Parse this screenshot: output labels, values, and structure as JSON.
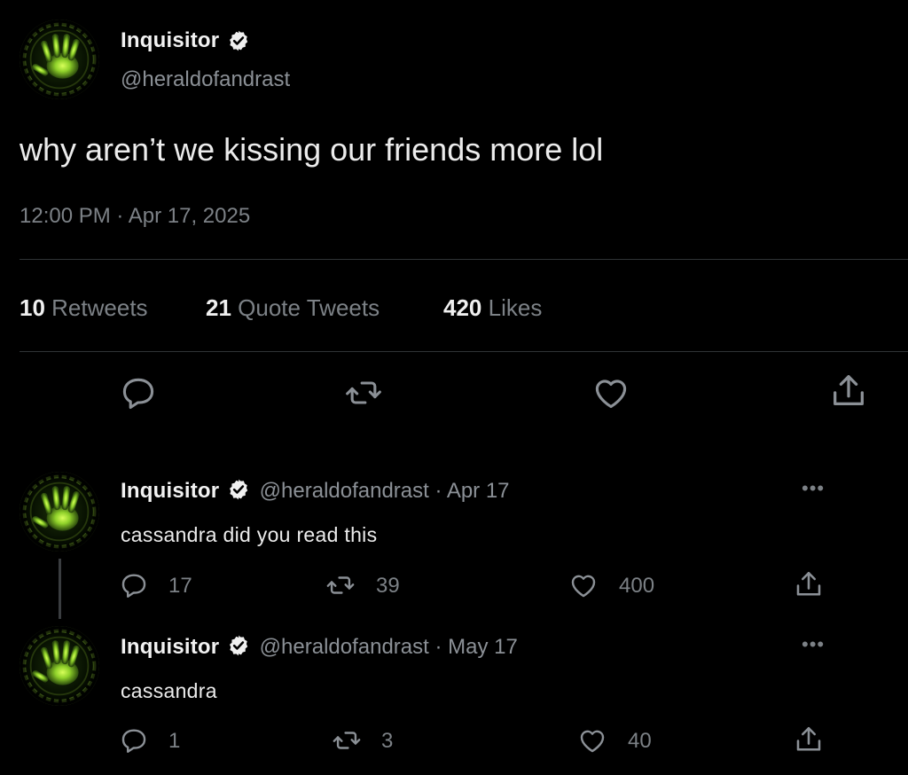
{
  "tweet": {
    "name": "Inquisitor",
    "handle": "@heraldofandrast",
    "text": "why aren’t we kissing our friends more lol",
    "timestamp": "12:00 PM · Apr 17, 2025",
    "stats": {
      "retweets_count": "10",
      "retweets_label": "Retweets",
      "quotes_count": "21",
      "quotes_label": "Quote Tweets",
      "likes_count": "420",
      "likes_label": "Likes"
    },
    "actions": [
      "reply-icon",
      "retweet-icon",
      "like-icon",
      "share-icon"
    ]
  },
  "replies": [
    {
      "name": "Inquisitor",
      "handle_date": "@heraldofandrast · Apr 17",
      "text": "cassandra did you read this",
      "replies": "17",
      "retweets": "39",
      "likes": "400",
      "more": "•••"
    },
    {
      "name": "Inquisitor",
      "handle_date": "@heraldofandrast · May 17",
      "text": "cassandra",
      "replies": "1",
      "retweets": "3",
      "likes": "40",
      "more": "•••"
    }
  ],
  "colors": {
    "background": "#000000",
    "text": "#e7e9ea",
    "muted": "#7c8186",
    "divider": "#2f3336",
    "avatar_glow": "#8fd12a"
  }
}
